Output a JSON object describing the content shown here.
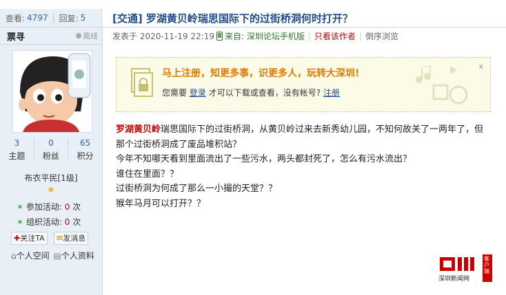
{
  "stats": {
    "views_label": "查看:",
    "views": "4797",
    "replies_label": "回复:",
    "replies": "5"
  },
  "thread_title": "[交通] 罗湖黄贝岭瑞思国际下的过街桥洞何时打开？",
  "user": {
    "name": "票寻",
    "status": "离线",
    "topics": "3",
    "topics_label": "主题",
    "fans": "0",
    "fans_label": "粉丝",
    "points": "65",
    "points_label": "积分",
    "rank": "布衣平民[1级]",
    "activity_join_label": "参加活动:",
    "activity_join": "0",
    "activity_org_label": "组织活动:",
    "activity_org": "0",
    "times_unit": "次",
    "follow": "关注TA",
    "message": "发消息",
    "space": "个人空间",
    "profile": "个人资料"
  },
  "post": {
    "posted_label": "发表于",
    "posted_time": "2020-11-19 22:19",
    "from_label": "来自:",
    "from_value": "深圳论坛手机版",
    "only_author": "只看该作者",
    "reverse": "倒序浏览"
  },
  "notice": {
    "headline": "马上注册，知更多事，识更多人，玩转大深圳!",
    "sub_prefix": "您需要",
    "login": "登录",
    "sub_middle": "才可以下载或查看，没有帐号?",
    "register": "注册",
    "close": "x"
  },
  "content": {
    "highlight": "罗湖黄贝岭",
    "line1_rest": "瑞思国际下的过街桥洞，从黄贝岭过来去新秀幼儿园，不知何故关了一两年了，但",
    "line2": "那个过街桥洞成了废品堆积站？",
    "line3": "今年不知哪天看到里面流出了一些污水，两头都封死了，怎么有污水流出？",
    "line4": "谁住在里面？？",
    "line5": "过街桥洞为何成了那么一小撮的天堂？？",
    "line6": "猴年马月可以打开？？"
  },
  "watermark": {
    "brand": "深圳新闻网",
    "tag": "客户端"
  },
  "colors": {
    "accent": "#1f4c8a",
    "highlight": "#c00000",
    "sidebar": "#e8eff7"
  }
}
